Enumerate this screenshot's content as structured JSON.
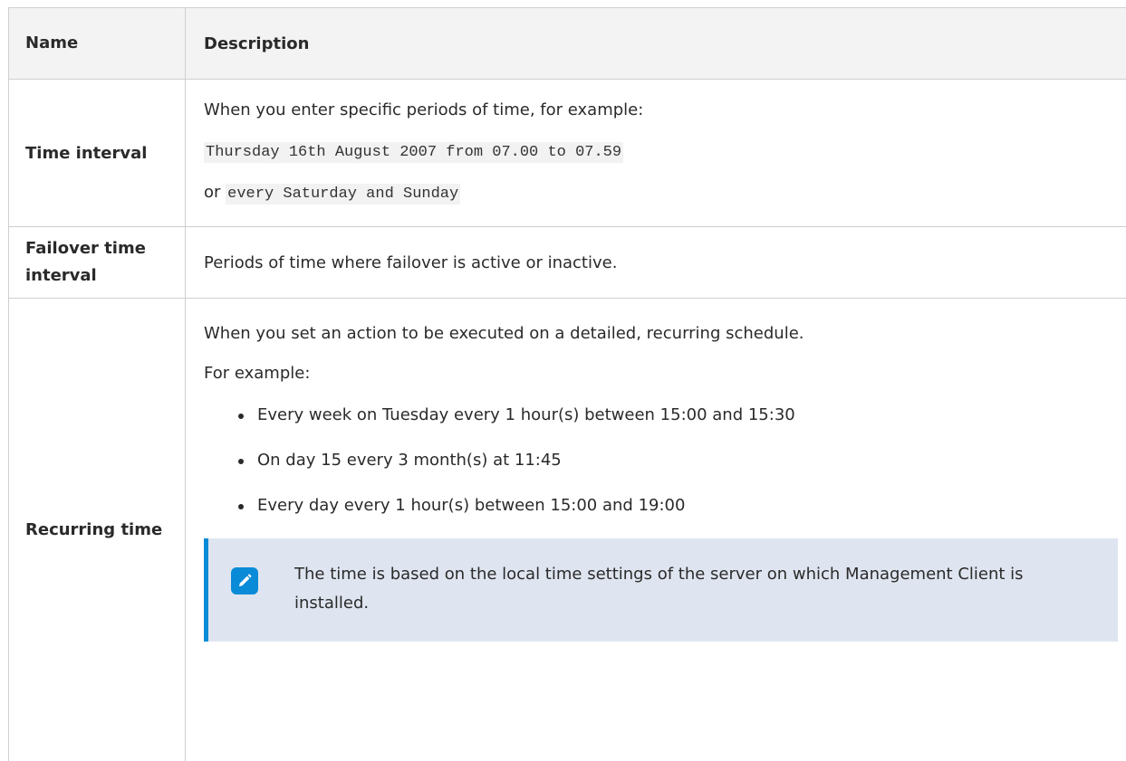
{
  "table": {
    "header": {
      "name": "Name",
      "description": "Description"
    },
    "rows": [
      {
        "name": "Time interval",
        "intro": "When you enter specific periods of time, for example:",
        "example1": "Thursday 16th August 2007 from 07.00 to 07.59",
        "or_label": "or",
        "example2": "every Saturday and Sunday"
      },
      {
        "name": "Failover time interval",
        "description": "Periods of time where failover is active or inactive."
      },
      {
        "name": "Recurring time",
        "intro": "When you set an action to be executed on a detailed, recurring schedule.",
        "for_example": "For example:",
        "bullets": [
          "Every week on Tuesday every 1 hour(s) between 15:00 and 15:30",
          "On day 15 every 3 month(s) at 11:45",
          "Every day every 1 hour(s) between 15:00 and 19:00"
        ],
        "note": {
          "icon": "pencil-icon",
          "text": "The time is based on the local time settings of the server on which Management Client is installed."
        }
      }
    ]
  },
  "colors": {
    "header_bg": "#f3f3f3",
    "note_bg": "#dfe5f0",
    "accent": "#0a8bd8",
    "border": "#cfcfcf"
  }
}
